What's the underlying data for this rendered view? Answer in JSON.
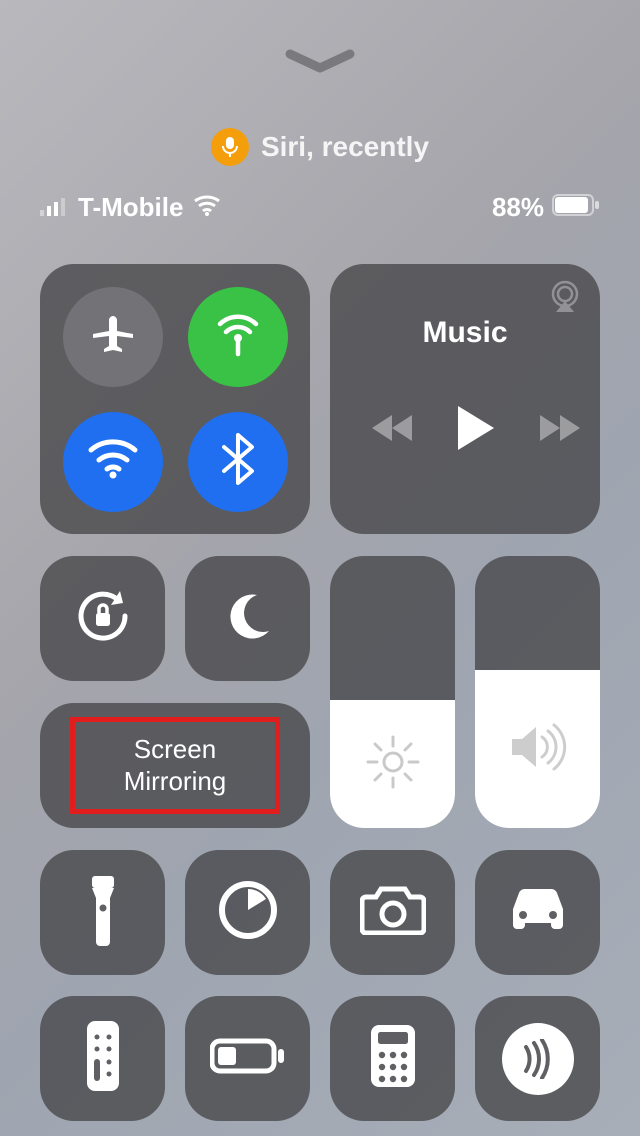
{
  "siri": {
    "label": "Siri, recently"
  },
  "status": {
    "carrier": "T-Mobile",
    "battery_percent": "88%"
  },
  "music": {
    "title": "Music"
  },
  "screen_mirroring": {
    "line1": "Screen",
    "line2": "Mirroring"
  },
  "sliders": {
    "brightness_percent": 47,
    "volume_percent": 58
  },
  "connectivity": {
    "airplane": false,
    "cellular": true,
    "wifi": true,
    "bluetooth": true
  },
  "shortcuts_row3": [
    "flashlight",
    "timer",
    "camera",
    "driving"
  ],
  "shortcuts_row4": [
    "remote",
    "low-power",
    "calculator",
    "nfc"
  ]
}
